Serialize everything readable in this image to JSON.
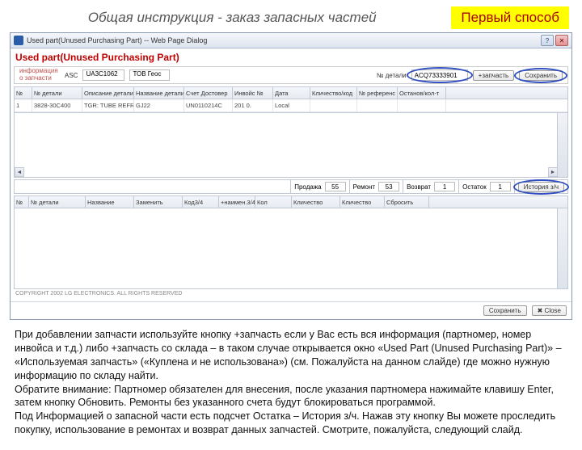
{
  "slide": {
    "title": "Общая инструкция - заказ запасных частей",
    "method": "Первый способ"
  },
  "window": {
    "title": "Used part(Unused Purchasing Part) -- Web Page Dialog",
    "page_header": "Used part(Unused Purchasing Part)",
    "help_btn": "?",
    "close_btn": "✕"
  },
  "infobar": {
    "label": "информация о запчасти",
    "asc_lbl": "ASC",
    "asc_val": "UA3C1062",
    "asc_name": "ТОВ Геос",
    "detail_lbl": "№ детали",
    "detail_val": "ACQ73333901",
    "add_btn": "+запчасть",
    "save_btn": "Сохранить"
  },
  "columns1": [
    "№",
    "№ детали",
    "Описание детали",
    "Название детали",
    "Счет Достовер",
    "Инвойс №",
    "Дата",
    "Кличество/код",
    "№ референс",
    "Останов/кол-т"
  ],
  "row1": [
    "1",
    "3828-30C400",
    "TGR: TUBE REFR",
    "GJ22",
    "UN0110214C",
    "201 0.",
    "Local",
    "",
    "",
    ""
  ],
  "columns2": [
    "№",
    "№ детали",
    "Название",
    "Заменить",
    "Код3/4",
    "+наимен.3/4",
    "Кол",
    "Кличество",
    "Кличество",
    "Сбросить"
  ],
  "totals": {
    "t1_lbl": "Продажа",
    "t1_val": "55",
    "t2_lbl": "Ремонт",
    "t2_val": "53",
    "t3_lbl": "Возврат",
    "t3_val": "1",
    "t4_lbl": "Остаток",
    "t4_val": "1",
    "history_btn": "История з/ч"
  },
  "footer": {
    "copyright": "COPYRIGHT 2002 LG ELECTRONICS. ALL RIGHTS RESERVED",
    "save": "Сохранить",
    "close": "Close"
  },
  "explanation": "При добавлении запчасти используйте кнопку +запчасть если у Вас есть вся информация (партномер, номер инвойса и т.д.) либо +запчасть со склада – в таком случае открывается окно «Used Part (Unused Purchasing Part)» – «Используемая запчасть» («Куплена и не использована») (см. Пожалуйста на данном слайде) где можно нужную информацию по складу найти.\nОбратите внимание: Партномер обязателен для внесения, после указания партномера нажимайте клавишу Enter, затем кнопку Обновить. Ремонты без указанного счета будут блокироваться программой.\nПод Информацией о запасной части есть подсчет Остатка – История з/ч. Нажав эту кнопку Вы можете проследить покупку, использование в ремонтах и возврат данных запчастей. Смотрите, пожалуйста, следующий слайд."
}
